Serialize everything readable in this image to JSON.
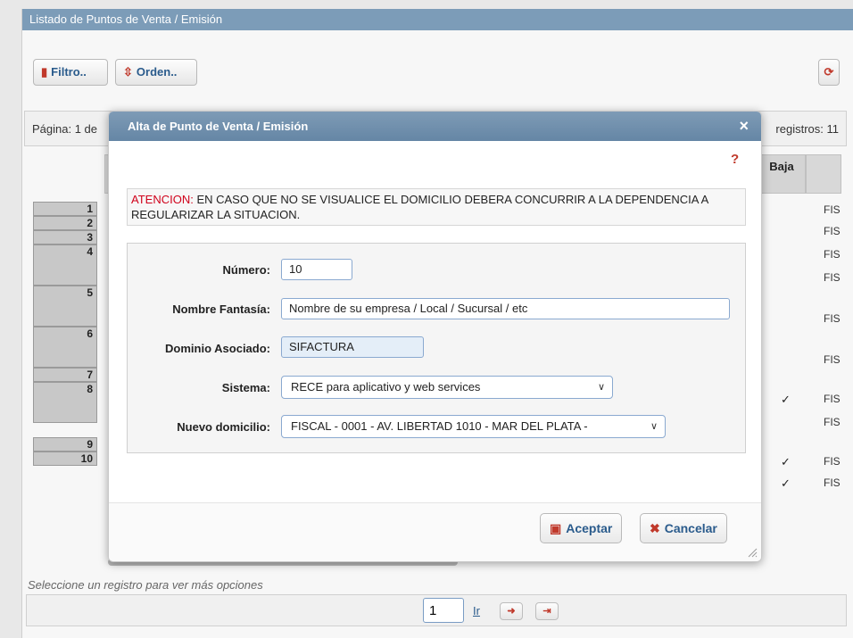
{
  "panel": {
    "title": "Listado de Puntos de Venta / Emisión",
    "filter_label": "Filtro..",
    "order_label": "Orden..",
    "refresh_icon": "refresh-icon"
  },
  "pager": {
    "page_info": "Página: 1 de",
    "records_info": "registros: 11",
    "page_value": "1",
    "go_label": "Ir"
  },
  "table": {
    "header_baja": "Baja",
    "row_numbers": [
      "1",
      "2",
      "3",
      "4",
      "5",
      "6",
      "7",
      "8",
      "9",
      "10"
    ],
    "last_col_text": "FIS",
    "checkmark": "✓"
  },
  "hint": "Seleccione un registro para ver más opciones",
  "modal": {
    "title": "Alta de Punto de Venta / Emisión",
    "close_icon": "×",
    "help_icon": "?",
    "warning_prefix": "ATENCION:",
    "warning_text": " EN CASO QUE NO SE VISUALICE EL DOMICILIO DEBERA CONCURRIR A LA DEPENDENCIA A REGULARIZAR LA SITUACION.",
    "form": {
      "numero_label": "Número:",
      "numero_value": "10",
      "nombre_label": "Nombre Fantasía:",
      "nombre_value": "Nombre de su empresa / Local / Sucursal / etc",
      "dominio_label": "Dominio Asociado:",
      "dominio_value": "SIFACTURA",
      "sistema_label": "Sistema:",
      "sistema_value": "RECE para aplicativo y web services",
      "domicilio_label": "Nuevo domicilio:",
      "domicilio_value": "FISCAL - 0001 - AV. LIBERTAD 1010 - MAR DEL PLATA -"
    },
    "accept_label": "Aceptar",
    "cancel_label": "Cancelar"
  },
  "colors": {
    "header_bg": "#7c9cb8",
    "accent_red": "#c0392b",
    "link_blue": "#2a5b8c"
  }
}
